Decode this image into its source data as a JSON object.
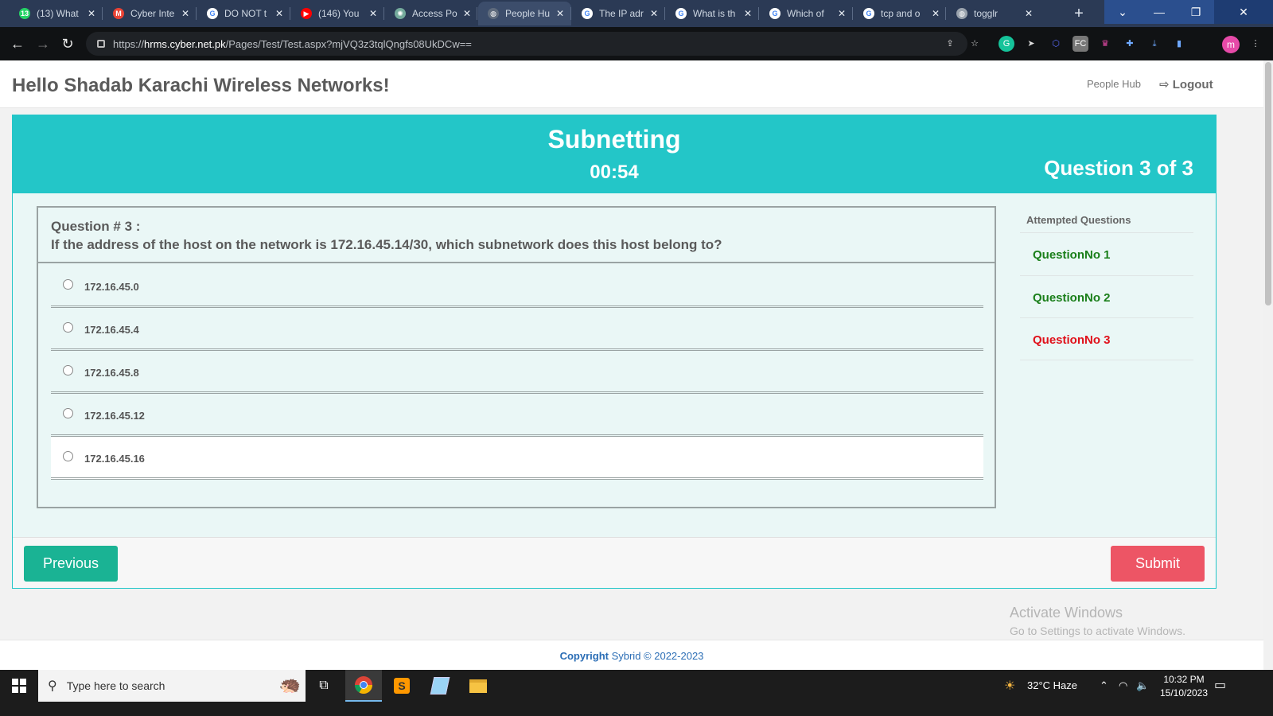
{
  "browser": {
    "tabs": [
      {
        "label": "(13) What",
        "icon": "whatsapp-icon",
        "color": "#25d366",
        "glyph": "13"
      },
      {
        "label": "Cyber Inte",
        "icon": "gmail-icon",
        "color": "#ea4335",
        "glyph": "M"
      },
      {
        "label": "DO NOT t",
        "icon": "google-icon",
        "color": "#ffffff",
        "glyph": "G"
      },
      {
        "label": "(146) You",
        "icon": "youtube-icon",
        "color": "#ff0000",
        "glyph": "▶"
      },
      {
        "label": "Access Po",
        "icon": "chatgpt-icon",
        "color": "#74aa9c",
        "glyph": "✺"
      },
      {
        "label": "People Hu",
        "icon": "globe-icon",
        "color": "#5f6b7d",
        "glyph": "◍"
      },
      {
        "label": "The IP adr",
        "icon": "google-icon",
        "color": "#ffffff",
        "glyph": "G"
      },
      {
        "label": "What is th",
        "icon": "google-icon",
        "color": "#ffffff",
        "glyph": "G"
      },
      {
        "label": "Which of",
        "icon": "google-icon",
        "color": "#ffffff",
        "glyph": "G"
      },
      {
        "label": "tcp and o",
        "icon": "google-icon",
        "color": "#ffffff",
        "glyph": "G"
      },
      {
        "label": "togglr",
        "icon": "globe-icon",
        "color": "#9aa3ad",
        "glyph": "◍"
      }
    ],
    "active_tab_index": 5,
    "url_prefix": "https://",
    "url_host": "hrms.cyber.net.pk",
    "url_path": "/Pages/Test/Test.aspx?mjVQ3z3tqlQngfs08UkDCw==",
    "avatar_letter": "m"
  },
  "header": {
    "greeting": "Hello Shadab Karachi Wireless Networks!",
    "nav_people_hub": "People Hub",
    "nav_logout": "Logout"
  },
  "test": {
    "title": "Subnetting",
    "timer": "00:54",
    "counter": "Question 3 of 3"
  },
  "question": {
    "number_label": "Question # 3 :",
    "text": "If the address of the host on the network is 172.16.45.14/30, which subnetwork does this host belong to?",
    "options": [
      "172.16.45.0",
      "172.16.45.4",
      "172.16.45.8",
      "172.16.45.12",
      "172.16.45.16"
    ]
  },
  "sidebar": {
    "title": "Attempted Questions",
    "items": [
      {
        "label": "QuestionNo 1",
        "color": "#1a7f1a"
      },
      {
        "label": "QuestionNo 2",
        "color": "#1a7f1a"
      },
      {
        "label": "QuestionNo 3",
        "color": "#e0101a"
      }
    ]
  },
  "buttons": {
    "previous": "Previous",
    "submit": "Submit"
  },
  "watermark": {
    "line1": "Activate Windows",
    "line2": "Go to Settings to activate Windows."
  },
  "footer": {
    "bold": "Copyright",
    "text": " Sybrid © 2022-2023"
  },
  "taskbar": {
    "search_placeholder": "Type here to search",
    "weather": "32°C  Haze",
    "time": "10:32 PM",
    "date": "15/10/2023"
  }
}
